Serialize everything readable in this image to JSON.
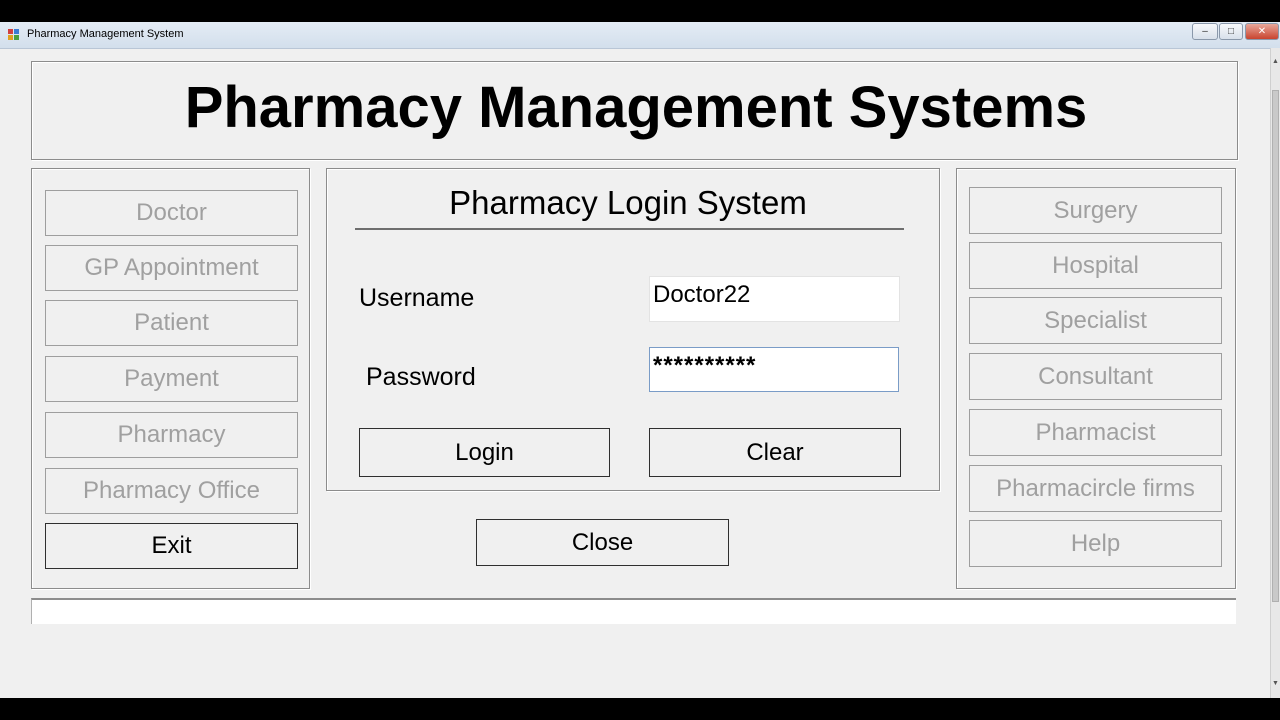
{
  "window": {
    "title": "Pharmacy Management System",
    "controls": {
      "minimize": "–",
      "maximize": "□",
      "close": "✕"
    }
  },
  "header": {
    "title": "Pharmacy Management Systems"
  },
  "left_menu": {
    "items": [
      {
        "label": "Doctor",
        "enabled": false
      },
      {
        "label": "GP Appointment",
        "enabled": false
      },
      {
        "label": "Patient",
        "enabled": false
      },
      {
        "label": "Payment",
        "enabled": false
      },
      {
        "label": "Pharmacy",
        "enabled": false
      },
      {
        "label": "Pharmacy Office",
        "enabled": false
      },
      {
        "label": "Exit",
        "enabled": true
      }
    ]
  },
  "login": {
    "title": "Pharmacy Login System",
    "username_label": "Username",
    "username_value": "Doctor22",
    "password_label": "Password",
    "password_value": "**********",
    "login_button": "Login",
    "clear_button": "Clear",
    "close_button": "Close"
  },
  "right_menu": {
    "items": [
      {
        "label": "Surgery",
        "enabled": false
      },
      {
        "label": "Hospital",
        "enabled": false
      },
      {
        "label": "Specialist",
        "enabled": false
      },
      {
        "label": "Consultant",
        "enabled": false
      },
      {
        "label": "Pharmacist",
        "enabled": false
      },
      {
        "label": "Pharmacircle firms",
        "enabled": false
      },
      {
        "label": "Help",
        "enabled": false
      }
    ]
  },
  "icons": {
    "app": "app-grid-icon"
  },
  "colors": {
    "disabled_text": "#a0a0a0",
    "enabled_text": "#000000",
    "form_bg": "#f0f0f0"
  }
}
